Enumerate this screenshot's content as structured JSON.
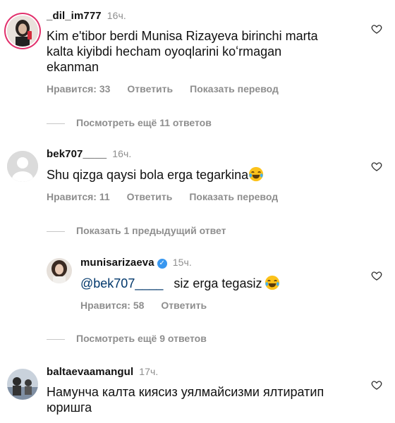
{
  "comments": [
    {
      "username": "_dil_im777",
      "time": "16ч.",
      "text": "Kim e'tibor berdi Munisa Rizayeva birinchi marta kalta kiyibdi hecham oyoqlarini ko'rmagan ekanman",
      "text_lines": [
        "Kim e'tibor berdi Munisa Rizayeva birinchi marta",
        "kalta kiyibdi hecham oyoqlarini koʻrmagan",
        "ekanman"
      ],
      "likes": "Нравится: 33",
      "reply": "Ответить",
      "translate": "Показать перевод",
      "view_replies": "Посмотреть ещё 11 ответов"
    },
    {
      "username": "bek707____",
      "time": "16ч.",
      "text": "Shu qizga qaysi bola erga tegarkina",
      "likes": "Нравится: 11",
      "reply": "Ответить",
      "translate": "Показать перевод",
      "show_previous": "Показать 1 предыдущий ответ"
    },
    {
      "username": "munisarizaeva",
      "time": "15ч.",
      "mention": "@bek707____",
      "text": "siz erga tegasiz",
      "likes": "Нравится: 58",
      "reply": "Ответить",
      "view_replies": "Посмотреть ещё 9 ответов"
    },
    {
      "username": "baltaevaamangul",
      "time": "17ч.",
      "text_lines": [
        "Намунча калта кияcиз уялмайсизми ялтиратип",
        "юришга"
      ]
    }
  ],
  "icons": {
    "like": "heart-outline-icon",
    "emoji": "tears-of-joy-emoji",
    "verified": "verified-badge-icon"
  },
  "colors": {
    "muted": "#8e8e8e",
    "mention": "#00376b",
    "verified": "#3897f0",
    "story_ring": "#e1306c"
  }
}
